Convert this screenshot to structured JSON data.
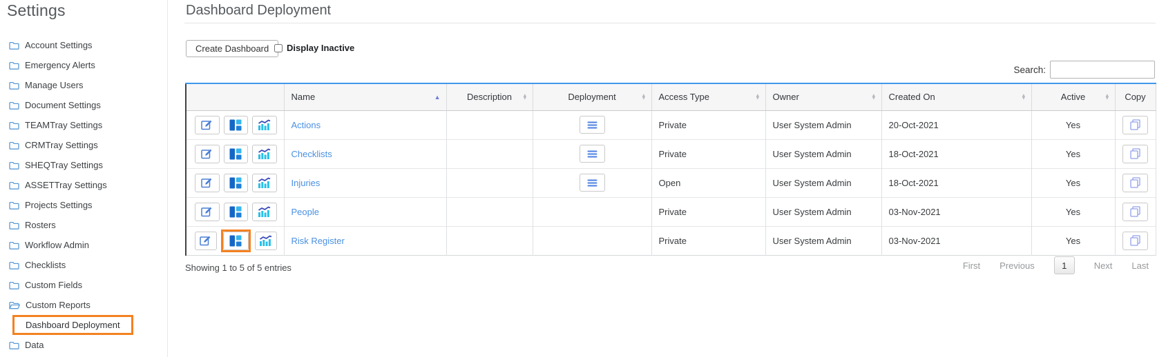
{
  "sidebar": {
    "title": "Settings",
    "items": [
      {
        "label": "Account Settings",
        "icon": "folder"
      },
      {
        "label": "Emergency Alerts",
        "icon": "folder"
      },
      {
        "label": "Manage Users",
        "icon": "folder"
      },
      {
        "label": "Document Settings",
        "icon": "folder"
      },
      {
        "label": "TEAMTray Settings",
        "icon": "folder"
      },
      {
        "label": "CRMTray Settings",
        "icon": "folder"
      },
      {
        "label": "SHEQTray Settings",
        "icon": "folder"
      },
      {
        "label": "ASSETTray Settings",
        "icon": "folder"
      },
      {
        "label": "Projects Settings",
        "icon": "folder"
      },
      {
        "label": "Rosters",
        "icon": "folder"
      },
      {
        "label": "Workflow Admin",
        "icon": "folder"
      },
      {
        "label": "Checklists",
        "icon": "folder"
      },
      {
        "label": "Custom Fields",
        "icon": "folder"
      },
      {
        "label": "Custom Reports",
        "icon": "folder-open"
      },
      {
        "label": "Dashboard Deployment",
        "icon": "none",
        "highlighted": true
      },
      {
        "label": "Data",
        "icon": "folder"
      }
    ]
  },
  "main": {
    "title": "Dashboard Deployment",
    "toolbar": {
      "create_button": "Create Dashboard",
      "display_inactive": "Display Inactive",
      "display_inactive_checked": false
    },
    "search": {
      "label": "Search:",
      "value": "",
      "placeholder": ""
    },
    "table": {
      "headers": {
        "actions": "",
        "name": "Name",
        "description": "Description",
        "deployment": "Deployment",
        "access_type": "Access Type",
        "owner": "Owner",
        "created_on": "Created On",
        "active": "Active",
        "copy": "Copy"
      },
      "sort": {
        "column": "Name",
        "direction": "asc"
      },
      "rows": [
        {
          "name": "Actions",
          "description": "",
          "has_deployment_menu": true,
          "access_type": "Private",
          "owner": "User System Admin",
          "created_on": "20-Oct-2021",
          "active": "Yes"
        },
        {
          "name": "Checklists",
          "description": "",
          "has_deployment_menu": true,
          "access_type": "Private",
          "owner": "User System Admin",
          "created_on": "18-Oct-2021",
          "active": "Yes"
        },
        {
          "name": "Injuries",
          "description": "",
          "has_deployment_menu": true,
          "access_type": "Open",
          "owner": "User System Admin",
          "created_on": "18-Oct-2021",
          "active": "Yes"
        },
        {
          "name": "People",
          "description": "",
          "has_deployment_menu": false,
          "access_type": "Private",
          "owner": "User System Admin",
          "created_on": "03-Nov-2021",
          "active": "Yes"
        },
        {
          "name": "Risk Register",
          "description": "",
          "has_deployment_menu": false,
          "access_type": "Private",
          "owner": "User System Admin",
          "created_on": "03-Nov-2021",
          "active": "Yes",
          "highlighted_button": "dashboard"
        }
      ]
    },
    "footer": {
      "info": "Showing 1 to 5 of 5 entries",
      "pagination": {
        "first": "First",
        "previous": "Previous",
        "page": "1",
        "next": "Next",
        "last": "Last"
      }
    }
  },
  "icons": {
    "folder": "folder-icon",
    "folder_open": "folder-open-icon",
    "edit": "pencil-square-icon",
    "dashboard": "dashboard-tiles-icon",
    "chart": "bar-chart-trend-icon",
    "deployment_menu": "hamburger-icon",
    "copy": "copy-pages-icon",
    "sort": "sort-arrows-icon"
  },
  "colors": {
    "accent_orange": "#f48120",
    "link_blue": "#4a90e2",
    "icon_dark_blue": "#1467c6",
    "icon_cyan": "#36b6ee",
    "icon_navy": "#3a4cb8",
    "copy_icon_blue": "#92a0ea",
    "folder_blue": "#5b9bd5",
    "table_top_border": "#3e97ea"
  }
}
